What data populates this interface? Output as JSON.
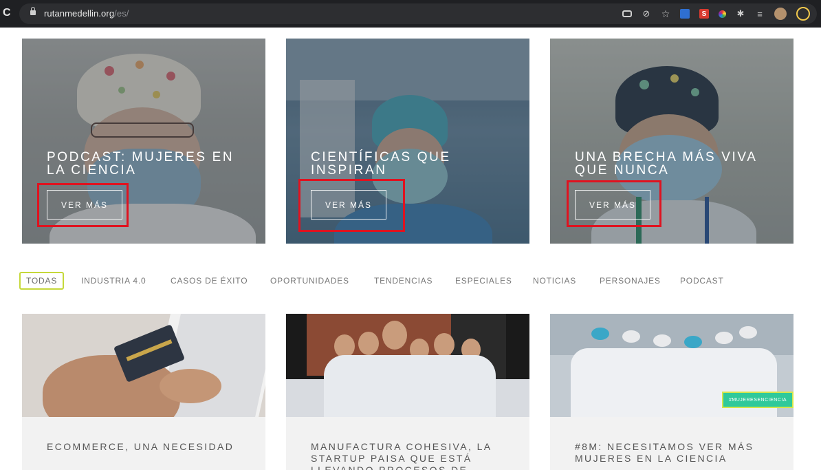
{
  "browser": {
    "url_domain": "rutanmedellin.org",
    "url_path": "/es/",
    "reload_glyph": "C",
    "icons": [
      "key-icon",
      "eye-off-icon",
      "star-icon",
      "extension-blue-icon",
      "extension-s-icon",
      "extension-color-icon",
      "puzzle-icon",
      "reading-list-icon",
      "profile-avatar",
      "account-ring"
    ],
    "ext_s_label": "S"
  },
  "hero_cards": [
    {
      "title": "PODCAST: MUJERES EN LA CIENCIA",
      "button": "VER MÁS"
    },
    {
      "title": "CIENTÍFICAS QUE INSPIRAN",
      "button": "VER MÁS"
    },
    {
      "title": "UNA BRECHA MÁS VIVA QUE NUNCA",
      "button": "VER MÁS"
    }
  ],
  "filters": {
    "active": "TODAS",
    "items": [
      "TODAS",
      "INDUSTRIA 4.0",
      "CASOS DE ÉXITO",
      "OPORTUNIDADES",
      "TENDENCIAS",
      "ESPECIALES",
      "NOTICIAS",
      "PERSONAJES",
      "PODCAST"
    ]
  },
  "articles": [
    {
      "title": "ECOMMERCE, UNA NECESIDAD"
    },
    {
      "title": "MANUFACTURA COHESIVA, LA STARTUP PAISA QUE ESTÁ LLEVANDO PROCESOS DE"
    },
    {
      "title": "#8M: NECESITAMOS VER MÁS MUJERES EN LA CIENCIA",
      "badge": "#MUJERESENCIENCIA"
    }
  ],
  "colors": {
    "highlight": "#e0121f",
    "active_filter_border": "#c5d83a",
    "badge": "#2fc99a"
  }
}
